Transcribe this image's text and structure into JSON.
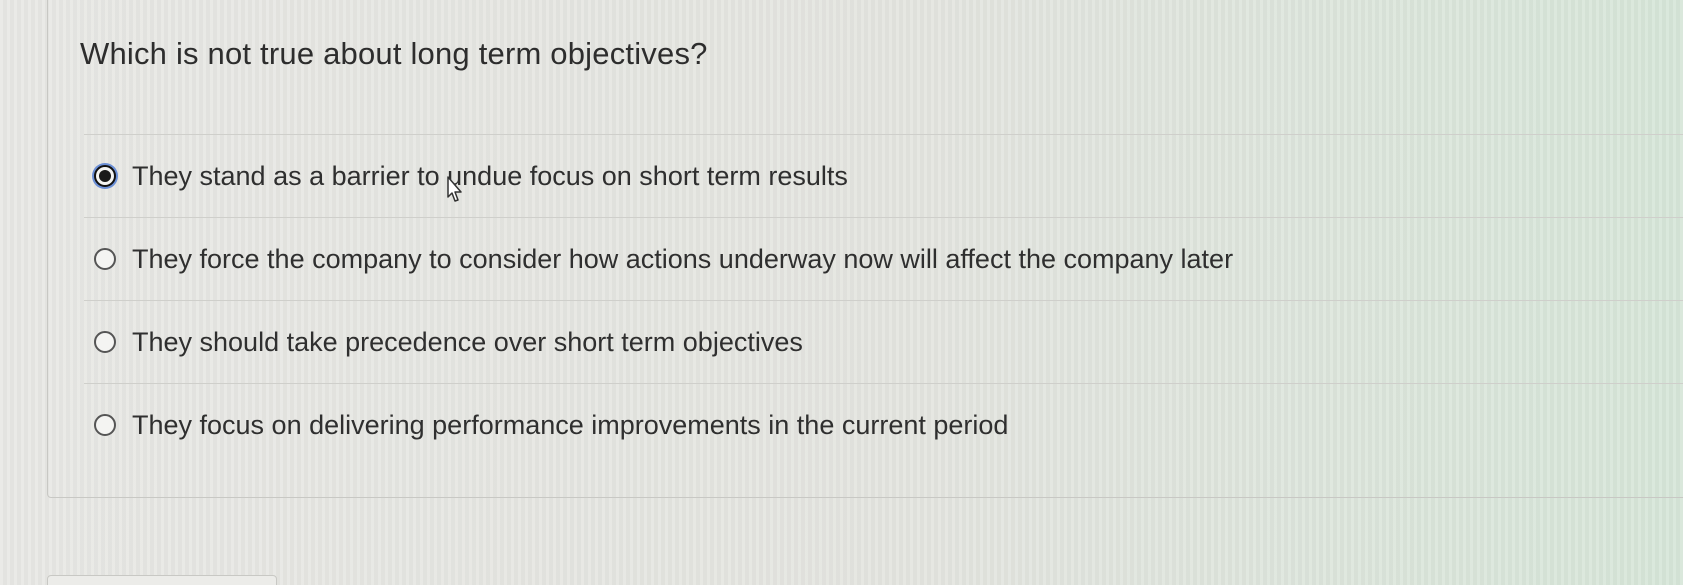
{
  "question": {
    "text": "Which is not true about long term objectives?"
  },
  "options": [
    {
      "label": "They stand as a barrier to undue focus on short term results",
      "selected": true
    },
    {
      "label": "They force the company to consider how actions underway now will affect the company later",
      "selected": false
    },
    {
      "label": "They should take precedence over short term objectives",
      "selected": false
    },
    {
      "label": "They focus on delivering performance improvements in the current period",
      "selected": false
    }
  ],
  "icons": {
    "cursor": "pointer-cursor-icon",
    "radio_selected": "radio-selected-icon",
    "radio_unselected": "radio-unselected-icon"
  },
  "colors": {
    "focus_ring": "#6b8fd6",
    "text": "#2f2f2f"
  }
}
